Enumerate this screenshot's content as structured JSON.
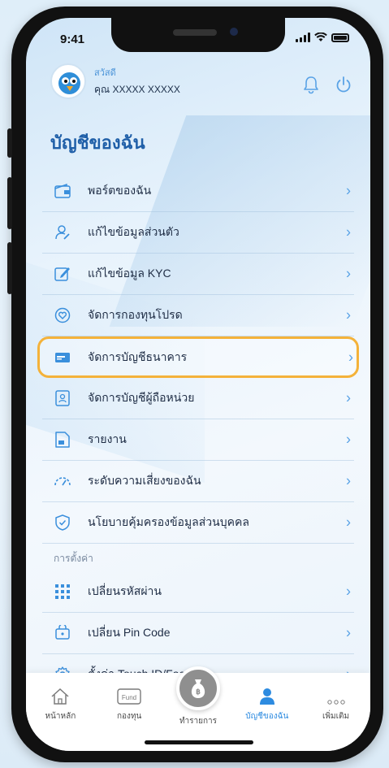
{
  "status_bar": {
    "time": "9:41"
  },
  "profile": {
    "greeting": "สวัสดี",
    "name": "คุณ XXXXX XXXXX"
  },
  "page_title": "บัญชีของฉัน",
  "menu_items": [
    {
      "label": "พอร์ตของฉัน",
      "icon": "wallet-icon"
    },
    {
      "label": "แก้ไขข้อมูลส่วนตัว",
      "icon": "user-edit-icon"
    },
    {
      "label": "แก้ไขข้อมูล KYC",
      "icon": "pencil-icon"
    },
    {
      "label": "จัดการกองทุนโปรด",
      "icon": "heart-icon"
    },
    {
      "label": "จัดการบัญชีธนาคาร",
      "icon": "bank-card-icon"
    },
    {
      "label": "จัดการบัญชีผู้ถือหน่วย",
      "icon": "unitholder-icon"
    },
    {
      "label": "รายงาน",
      "icon": "report-icon"
    },
    {
      "label": "ระดับความเสี่ยงของฉัน",
      "icon": "risk-gauge-icon"
    },
    {
      "label": "นโยบายคุ้มครองข้อมูลส่วนบุคคล",
      "icon": "shield-check-icon"
    }
  ],
  "settings_label": "การตั้งค่า",
  "settings_items": [
    {
      "label": "เปลี่ยนรหัสผ่าน",
      "icon": "keypad-icon"
    },
    {
      "label": "เปลี่ยน Pin Code",
      "icon": "pin-code-icon"
    },
    {
      "label": "ตั้งค่า Touch ID/Face ID",
      "icon": "gear-icon"
    }
  ],
  "tabbar": {
    "home": "หน้าหลัก",
    "funds": "กองทุน",
    "fund_badge": "Fund",
    "transaction": "ทำรายการ",
    "account": "บัญชีของฉัน",
    "more": "เพิ่มเติม"
  },
  "colors": {
    "accent": "#2d8be0",
    "title": "#1f5fa8",
    "highlight": "#f4b23a"
  }
}
